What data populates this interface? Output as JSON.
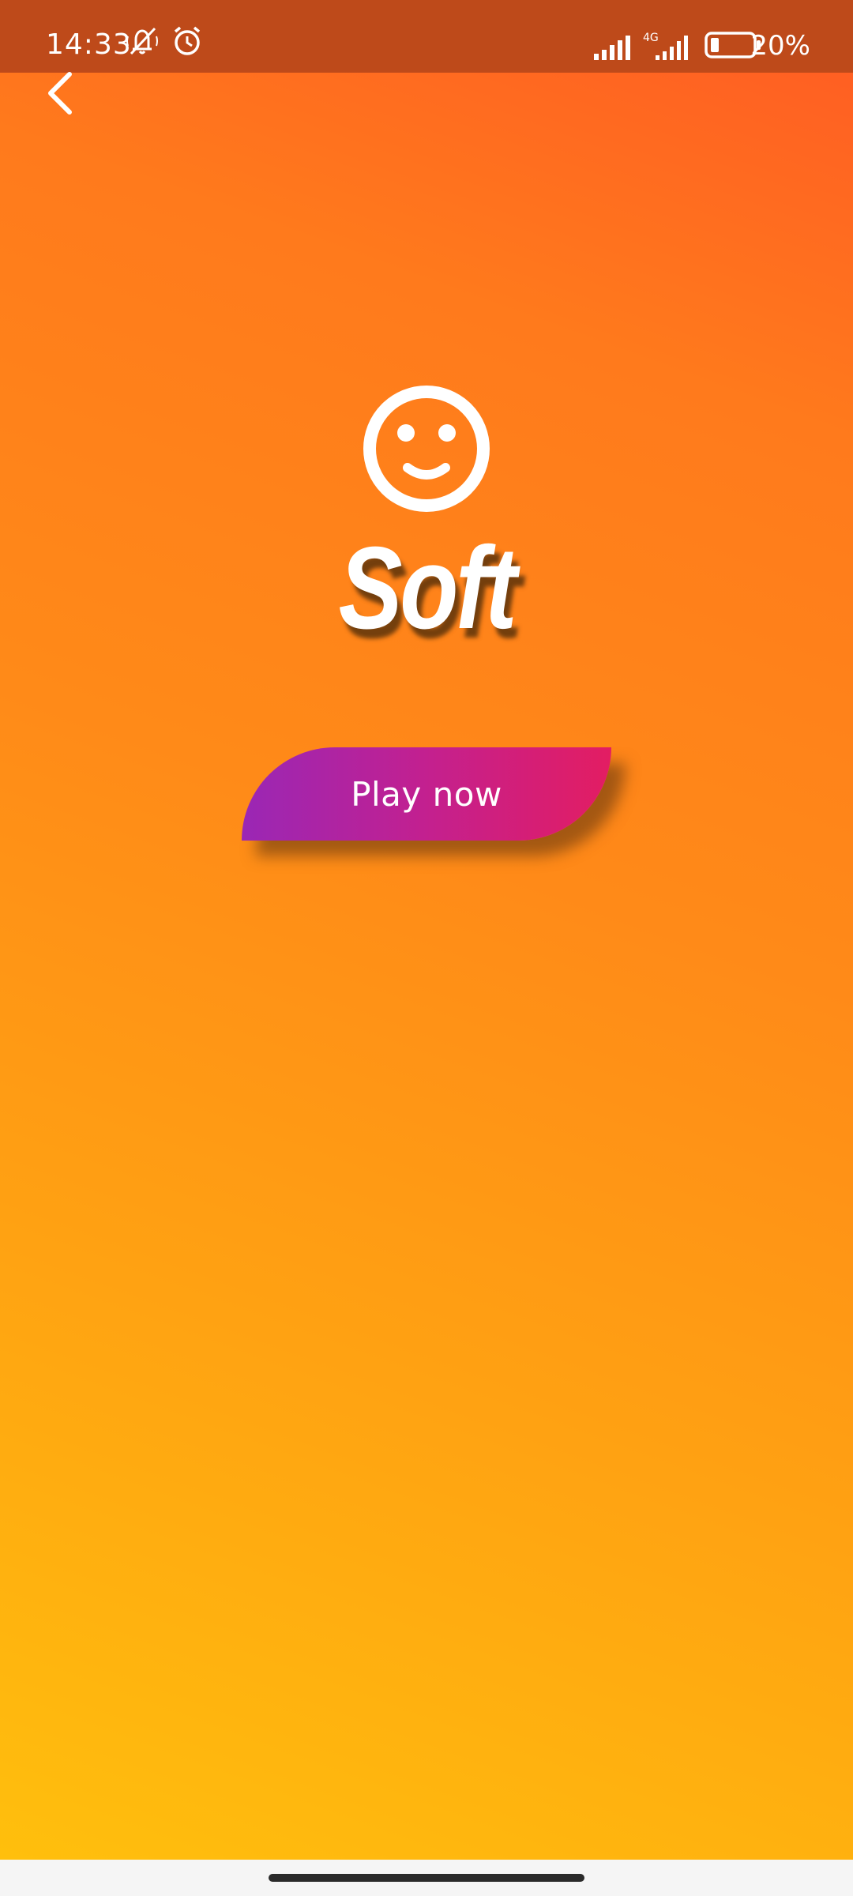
{
  "status_bar": {
    "time": "14:33",
    "battery_percent": "20%",
    "network_label": "4G",
    "icons": [
      "muted-notification-icon",
      "alarm-icon",
      "signal-icon",
      "signal-4g-icon",
      "battery-icon"
    ]
  },
  "nav": {
    "back_icon": "chevron-left-icon"
  },
  "main": {
    "mood_icon": "smiley-face-icon",
    "title": "Soft",
    "play_button_label": "Play now"
  },
  "colors": {
    "status_bar": "#be4a1a",
    "gradient_top": "#ff5a24",
    "gradient_bottom": "#ffc10c",
    "button_start": "#9a27b5",
    "button_end": "#e31d62",
    "foreground": "#ffffff"
  }
}
